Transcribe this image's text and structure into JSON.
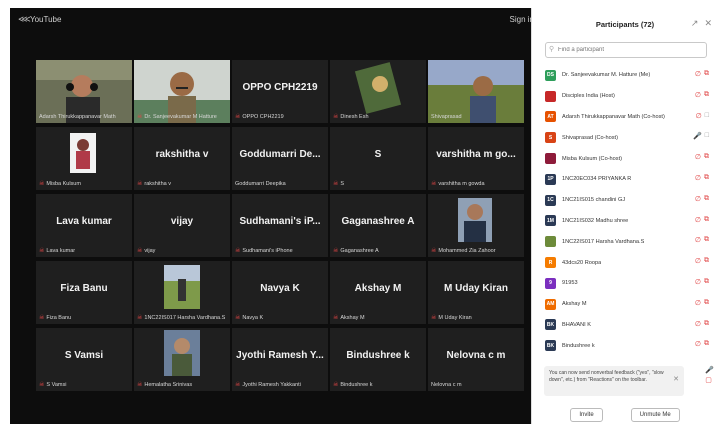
{
  "topbar": {
    "source": "YouTube",
    "signin": "Sign in"
  },
  "tiles": [
    {
      "name": "",
      "label": "Adarsh Thirukkappanavar Math",
      "video": "man-headphones",
      "muted": false,
      "active": true
    },
    {
      "name": "",
      "label": "Dr. Sanjeevakumar M Hatture",
      "video": "man-mustache",
      "muted": true
    },
    {
      "name": "OPPO CPH2219",
      "label": "OPPO CPH2219",
      "muted": true
    },
    {
      "name": "",
      "label": "Dinesh Esh",
      "video": "photo-object",
      "muted": true
    },
    {
      "name": "",
      "label": "Shivaprasad",
      "video": "man-outdoor",
      "muted": false
    },
    {
      "name": "",
      "label": "Misba Kulsum",
      "video": "portrait-woman",
      "muted": true
    },
    {
      "name": "rakshitha v",
      "label": "rakshitha v",
      "muted": true
    },
    {
      "name": "Goddumarri De...",
      "label": "Goddumarri Deepika",
      "muted": false
    },
    {
      "name": "S",
      "label": "S",
      "muted": true
    },
    {
      "name": "varshitha m go...",
      "label": "varshitha m gowda",
      "muted": true
    },
    {
      "name": "Lava kumar",
      "label": "Lava kumar",
      "muted": true
    },
    {
      "name": "vijay",
      "label": "vijay",
      "muted": true
    },
    {
      "name": "Sudhamani's iP...",
      "label": "Sudhamani's iPhone",
      "muted": true
    },
    {
      "name": "Gaganashree A",
      "label": "Gaganashree A",
      "muted": true
    },
    {
      "name": "",
      "label": "Mohammed Zia Zahoor",
      "video": "man-portrait",
      "muted": true
    },
    {
      "name": "Fiza Banu",
      "label": "Fiza Banu",
      "muted": true
    },
    {
      "name": "",
      "label": "1NC22IS017 Harsha Vardhana.S",
      "video": "outdoor-person",
      "muted": true
    },
    {
      "name": "Navya K",
      "label": "Navya K",
      "muted": true
    },
    {
      "name": "Akshay M",
      "label": "Akshay M",
      "muted": true
    },
    {
      "name": "M Uday Kiran",
      "label": "M Uday Kiran",
      "muted": true
    },
    {
      "name": "S Vamsi",
      "label": "S Vamsi",
      "muted": true
    },
    {
      "name": "",
      "label": "Hemalatha Srinivas",
      "video": "man-selfie",
      "muted": true
    },
    {
      "name": "Jyothi Ramesh Y...",
      "label": "Jyothi Ramesh Yakkanti",
      "muted": true
    },
    {
      "name": "Bindushree k",
      "label": "Bindushree k",
      "muted": true
    },
    {
      "name": "Nelovna c m",
      "label": "Nelovna c m",
      "muted": false
    }
  ],
  "sidebar": {
    "title": "Participants (72)",
    "search_placeholder": "Find a participant",
    "participants": [
      {
        "initials": "DS",
        "color": "#2e9e5b",
        "name": "Dr. Sanjeevakumar M. Hatture (Me)",
        "mic": "muted",
        "cam": "off"
      },
      {
        "initials": "",
        "color": "#c62828",
        "name": "Disciples India (Host)",
        "mic": "muted",
        "cam": "off"
      },
      {
        "initials": "AT",
        "color": "#e65100",
        "name": "Adarsh Thirukkappanavar Math (Co-host)",
        "mic": "muted",
        "cam": "on"
      },
      {
        "initials": "S",
        "color": "#d84315",
        "name": "Shivaprasad (Co-host)",
        "mic": "on",
        "cam": "on"
      },
      {
        "initials": "",
        "color": "#8e1b3a",
        "name": "Misba Kulsum (Co-host)",
        "mic": "muted",
        "cam": "off"
      },
      {
        "initials": "1P",
        "color": "#2b3a55",
        "name": "1NC20EC034 PRIYANKA R",
        "mic": "muted",
        "cam": "off"
      },
      {
        "initials": "1C",
        "color": "#2b3a55",
        "name": "1NC21IS015 chandini GJ",
        "mic": "muted",
        "cam": "off"
      },
      {
        "initials": "1M",
        "color": "#2b3a55",
        "name": "1NC21IS032 Madhu shree",
        "mic": "muted",
        "cam": "off"
      },
      {
        "initials": "",
        "color": "#6d8b3a",
        "name": "1NC22IS017 Harsha Vardhana.S",
        "mic": "muted",
        "cam": "off"
      },
      {
        "initials": "R",
        "color": "#f57c00",
        "name": "43dcs20 Roopa",
        "mic": "muted",
        "cam": "off"
      },
      {
        "initials": "9",
        "color": "#7b2fbf",
        "name": "91953",
        "mic": "muted",
        "cam": "off"
      },
      {
        "initials": "AM",
        "color": "#ef6c00",
        "name": "Akshay M",
        "mic": "muted",
        "cam": "off"
      },
      {
        "initials": "BK",
        "color": "#2b3a55",
        "name": "BHAVANI K",
        "mic": "muted",
        "cam": "off"
      },
      {
        "initials": "BK",
        "color": "#2b3a55",
        "name": "Bindushree k",
        "mic": "muted",
        "cam": "off"
      }
    ],
    "tip": "You can now send nonverbal feedback (\"yes\", \"slow down\", etc.) from \"Reactions\" on the toolbar.",
    "invite_label": "Invite",
    "unmute_label": "Unmute Me"
  }
}
